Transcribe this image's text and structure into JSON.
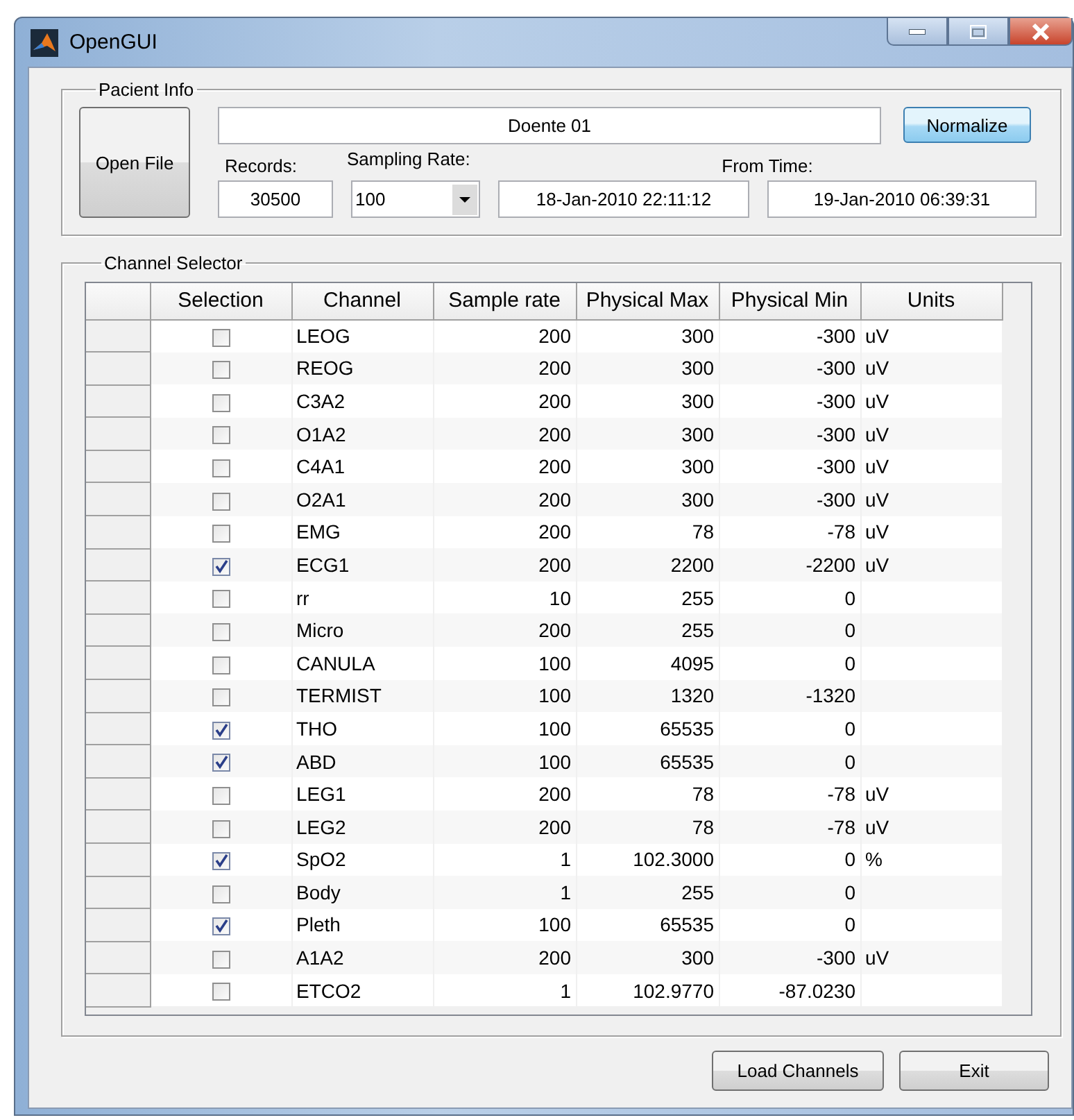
{
  "window": {
    "title": "OpenGUI"
  },
  "patient_info": {
    "legend": "Pacient Info",
    "open_button": "Open File",
    "name": "Doente 01",
    "normalize_button": "Normalize",
    "records_label": "Records:",
    "records": "30500",
    "sampling_label": "Sampling Rate:",
    "sampling_rate": "100",
    "from_time_label": "From Time:",
    "from_time": "18-Jan-2010 22:11:12",
    "to_time": "19-Jan-2010 06:39:31"
  },
  "channel_selector": {
    "legend": "Channel Selector",
    "columns": [
      "Selection",
      "Channel",
      "Sample rate",
      "Physical Max",
      "Physical Min",
      "Units"
    ],
    "rows": [
      {
        "checked": false,
        "channel": "LEOG",
        "sample_rate": "200",
        "physical_max": "300",
        "physical_min": "-300",
        "units": "uV"
      },
      {
        "checked": false,
        "channel": "REOG",
        "sample_rate": "200",
        "physical_max": "300",
        "physical_min": "-300",
        "units": "uV"
      },
      {
        "checked": false,
        "channel": "C3A2",
        "sample_rate": "200",
        "physical_max": "300",
        "physical_min": "-300",
        "units": "uV"
      },
      {
        "checked": false,
        "channel": "O1A2",
        "sample_rate": "200",
        "physical_max": "300",
        "physical_min": "-300",
        "units": "uV"
      },
      {
        "checked": false,
        "channel": "C4A1",
        "sample_rate": "200",
        "physical_max": "300",
        "physical_min": "-300",
        "units": "uV"
      },
      {
        "checked": false,
        "channel": "O2A1",
        "sample_rate": "200",
        "physical_max": "300",
        "physical_min": "-300",
        "units": "uV"
      },
      {
        "checked": false,
        "channel": "EMG",
        "sample_rate": "200",
        "physical_max": "78",
        "physical_min": "-78",
        "units": "uV"
      },
      {
        "checked": true,
        "channel": "ECG1",
        "sample_rate": "200",
        "physical_max": "2200",
        "physical_min": "-2200",
        "units": "uV"
      },
      {
        "checked": false,
        "channel": "rr",
        "sample_rate": "10",
        "physical_max": "255",
        "physical_min": "0"
      },
      {
        "checked": false,
        "channel": "Micro",
        "sample_rate": "200",
        "physical_max": "255",
        "physical_min": "0"
      },
      {
        "checked": false,
        "channel": "CANULA",
        "sample_rate": "100",
        "physical_max": "4095",
        "physical_min": "0"
      },
      {
        "checked": false,
        "channel": "TERMIST",
        "sample_rate": "100",
        "physical_max": "1320",
        "physical_min": "-1320"
      },
      {
        "checked": true,
        "channel": "THO",
        "sample_rate": "100",
        "physical_max": "65535",
        "physical_min": "0"
      },
      {
        "checked": true,
        "channel": "ABD",
        "sample_rate": "100",
        "physical_max": "65535",
        "physical_min": "0"
      },
      {
        "checked": false,
        "channel": "LEG1",
        "sample_rate": "200",
        "physical_max": "78",
        "physical_min": "-78",
        "units": "uV"
      },
      {
        "checked": false,
        "channel": "LEG2",
        "sample_rate": "200",
        "physical_max": "78",
        "physical_min": "-78",
        "units": "uV"
      },
      {
        "checked": true,
        "channel": "SpO2",
        "sample_rate": "1",
        "physical_max": "102.3000",
        "physical_min": "0",
        "units": "%"
      },
      {
        "checked": false,
        "channel": "Body",
        "sample_rate": "1",
        "physical_max": "255",
        "physical_min": "0"
      },
      {
        "checked": true,
        "channel": "Pleth",
        "sample_rate": "100",
        "physical_max": "65535",
        "physical_min": "0"
      },
      {
        "checked": false,
        "channel": "A1A2",
        "sample_rate": "200",
        "physical_max": "300",
        "physical_min": "-300",
        "units": "uV"
      },
      {
        "checked": false,
        "channel": "ETCO2",
        "sample_rate": "1",
        "physical_max": "102.9770",
        "physical_min": "-87.0230"
      }
    ]
  },
  "buttons": [
    "Load Channels",
    "Exit"
  ]
}
